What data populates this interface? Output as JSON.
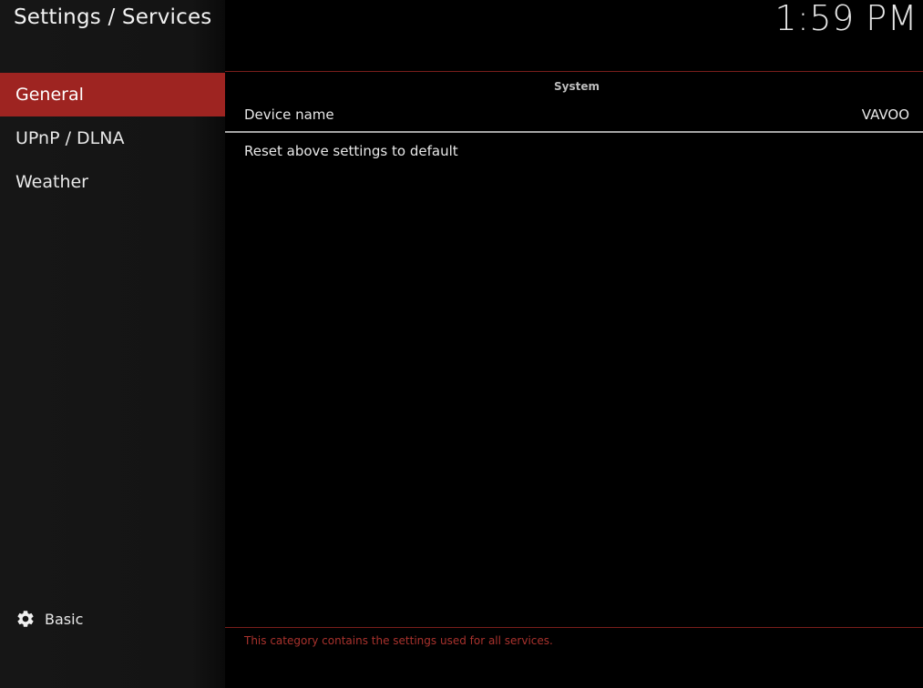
{
  "header": {
    "title": "Settings / Services",
    "clock": "1:59 PM"
  },
  "sidebar": {
    "items": [
      {
        "label": "General",
        "active": true
      },
      {
        "label": "UPnP / DLNA",
        "active": false
      },
      {
        "label": "Weather",
        "active": false
      }
    ],
    "level": {
      "icon": "gear-icon",
      "label": "Basic"
    }
  },
  "main": {
    "group_title": "System",
    "settings": [
      {
        "label": "Device name",
        "value": "VAVOO"
      },
      {
        "label": "Reset above settings to default",
        "value": ""
      }
    ]
  },
  "footer": {
    "description": "This category contains the settings used for all services."
  },
  "colors": {
    "accent": "#9e2421",
    "divider": "#7a1e1b",
    "description_text": "#a8322d"
  }
}
